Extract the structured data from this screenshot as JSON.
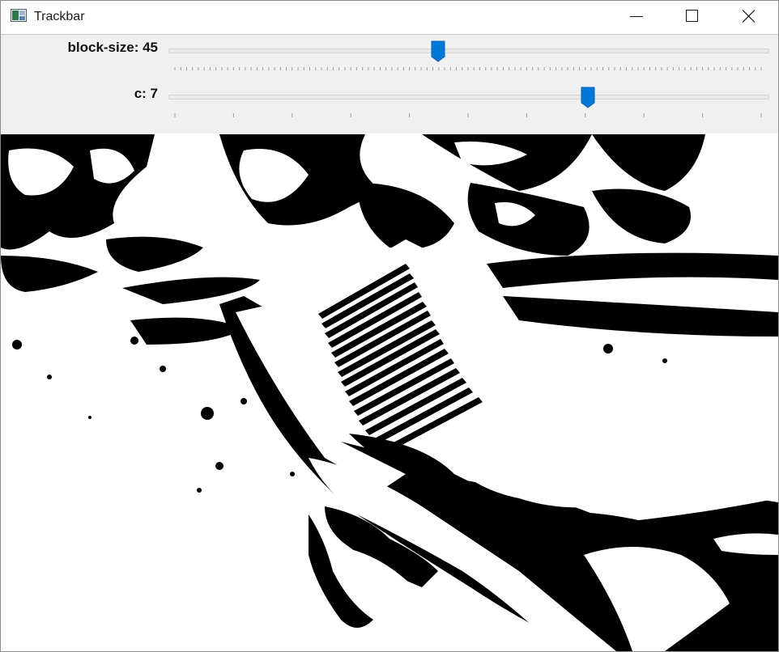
{
  "window": {
    "title": "Trackbar",
    "app_icon": "opencv-window-icon",
    "controls": {
      "minimize": "minimize-icon",
      "maximize": "maximize-icon",
      "close": "close-icon"
    }
  },
  "trackbars": [
    {
      "label": "block-size: 45",
      "name": "block-size",
      "value": 45,
      "position_fraction": 0.45
    },
    {
      "label": "c: 7",
      "name": "c",
      "value": 7,
      "position_fraction": 0.7
    }
  ],
  "image": {
    "description_icon": "thresholded-image"
  },
  "colors": {
    "thumb": "#0078d7",
    "panel": "#f0f0f0",
    "foreground": "#000000",
    "background": "#ffffff"
  }
}
